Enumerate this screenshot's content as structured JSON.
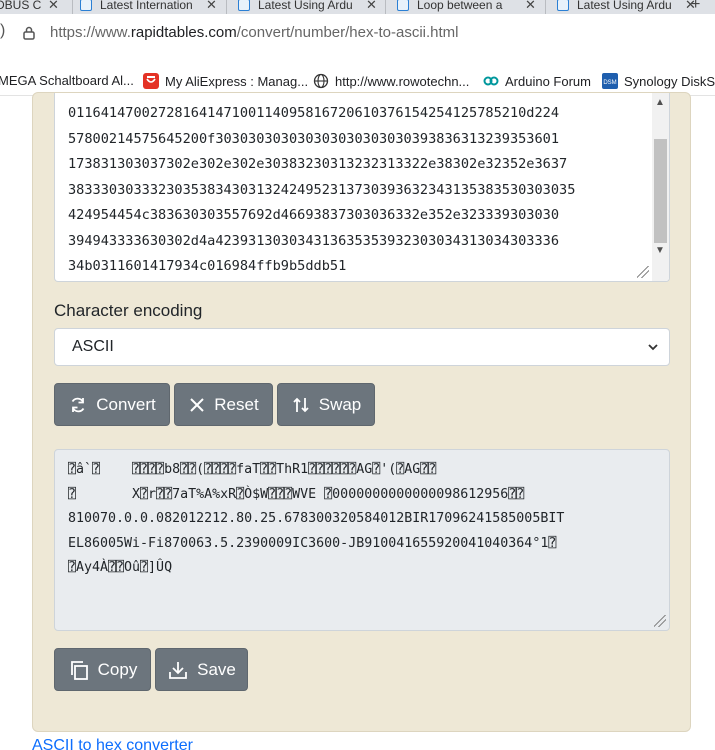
{
  "browser": {
    "tabs": [
      {
        "title": "DBUS C"
      },
      {
        "title": "Latest Internation"
      },
      {
        "title": "Latest Using Ardu"
      },
      {
        "title": "Loop between a"
      },
      {
        "title": "Latest Using Ardu"
      }
    ],
    "url_prefix": "https://www.",
    "url_host": "rapidtables.com",
    "url_path": "/convert/number/hex-to-ascii.html",
    "bookmarks": [
      {
        "label": "MEGA Schaltboard Al...",
        "icon": "page-icon"
      },
      {
        "label": "My AliExpress : Manag...",
        "icon": "aliexpress-icon"
      },
      {
        "label": "http://www.rowotechn...",
        "icon": "globe-icon"
      },
      {
        "label": "Arduino Forum",
        "icon": "arduino-icon"
      },
      {
        "label": "Synology DiskSt",
        "icon": "synology-icon"
      }
    ]
  },
  "converter": {
    "hex_lines": [
      "01164147002728164147100114095816720610376154254125785210d224",
      "57800214575645200f303030303030303030303030393836313239353601",
      "173831303037302e302e302e30383230313232313322e38302e32352e3637",
      "38333030333230353834303132424952313730393632343135383530303035",
      "424954454c383630303557692d46693837303036332e352e323339303030",
      "394943333630302d4a423931303034313635353932303034313034303336",
      "34b0311601417934c016984ffb9b5ddb51"
    ],
    "encoding_label": "Character encoding",
    "encoding_value": "ASCII",
    "buttons": {
      "convert": "Convert",
      "reset": "Reset",
      "swap": "Swap",
      "copy": "Copy",
      "save": "Save"
    },
    "output_lines": [
      "⍰â`⍰    ⍰⍰⍰⍰b8⍰⍰(⍰⍰⍰⍰faT⍰⍰ThR1⍰⍰⍰⍰⍰⍰AG⍰'(⍰AG⍰⍰",
      "⍰       X⍰r⍰⍰7aT%A%xR⍰Ò$W⍰⍰⍰WVE ⍰0000000000000098612956⍰⍰",
      "810070.0.0.082012212.80.25.678300320584012BIR17096241585005BIT",
      "EL86005Wi-Fi870063.5.2390009IC3600-JB910041655920041040364°1⍰",
      "⍰Ay4À⍰⍰Oû⍰]ÛQ"
    ]
  },
  "below_link": "ASCII to hex converter",
  "colors": {
    "card_bg": "#eee8d6",
    "button_bg": "#6c757d",
    "output_bg": "#e9ecef"
  }
}
